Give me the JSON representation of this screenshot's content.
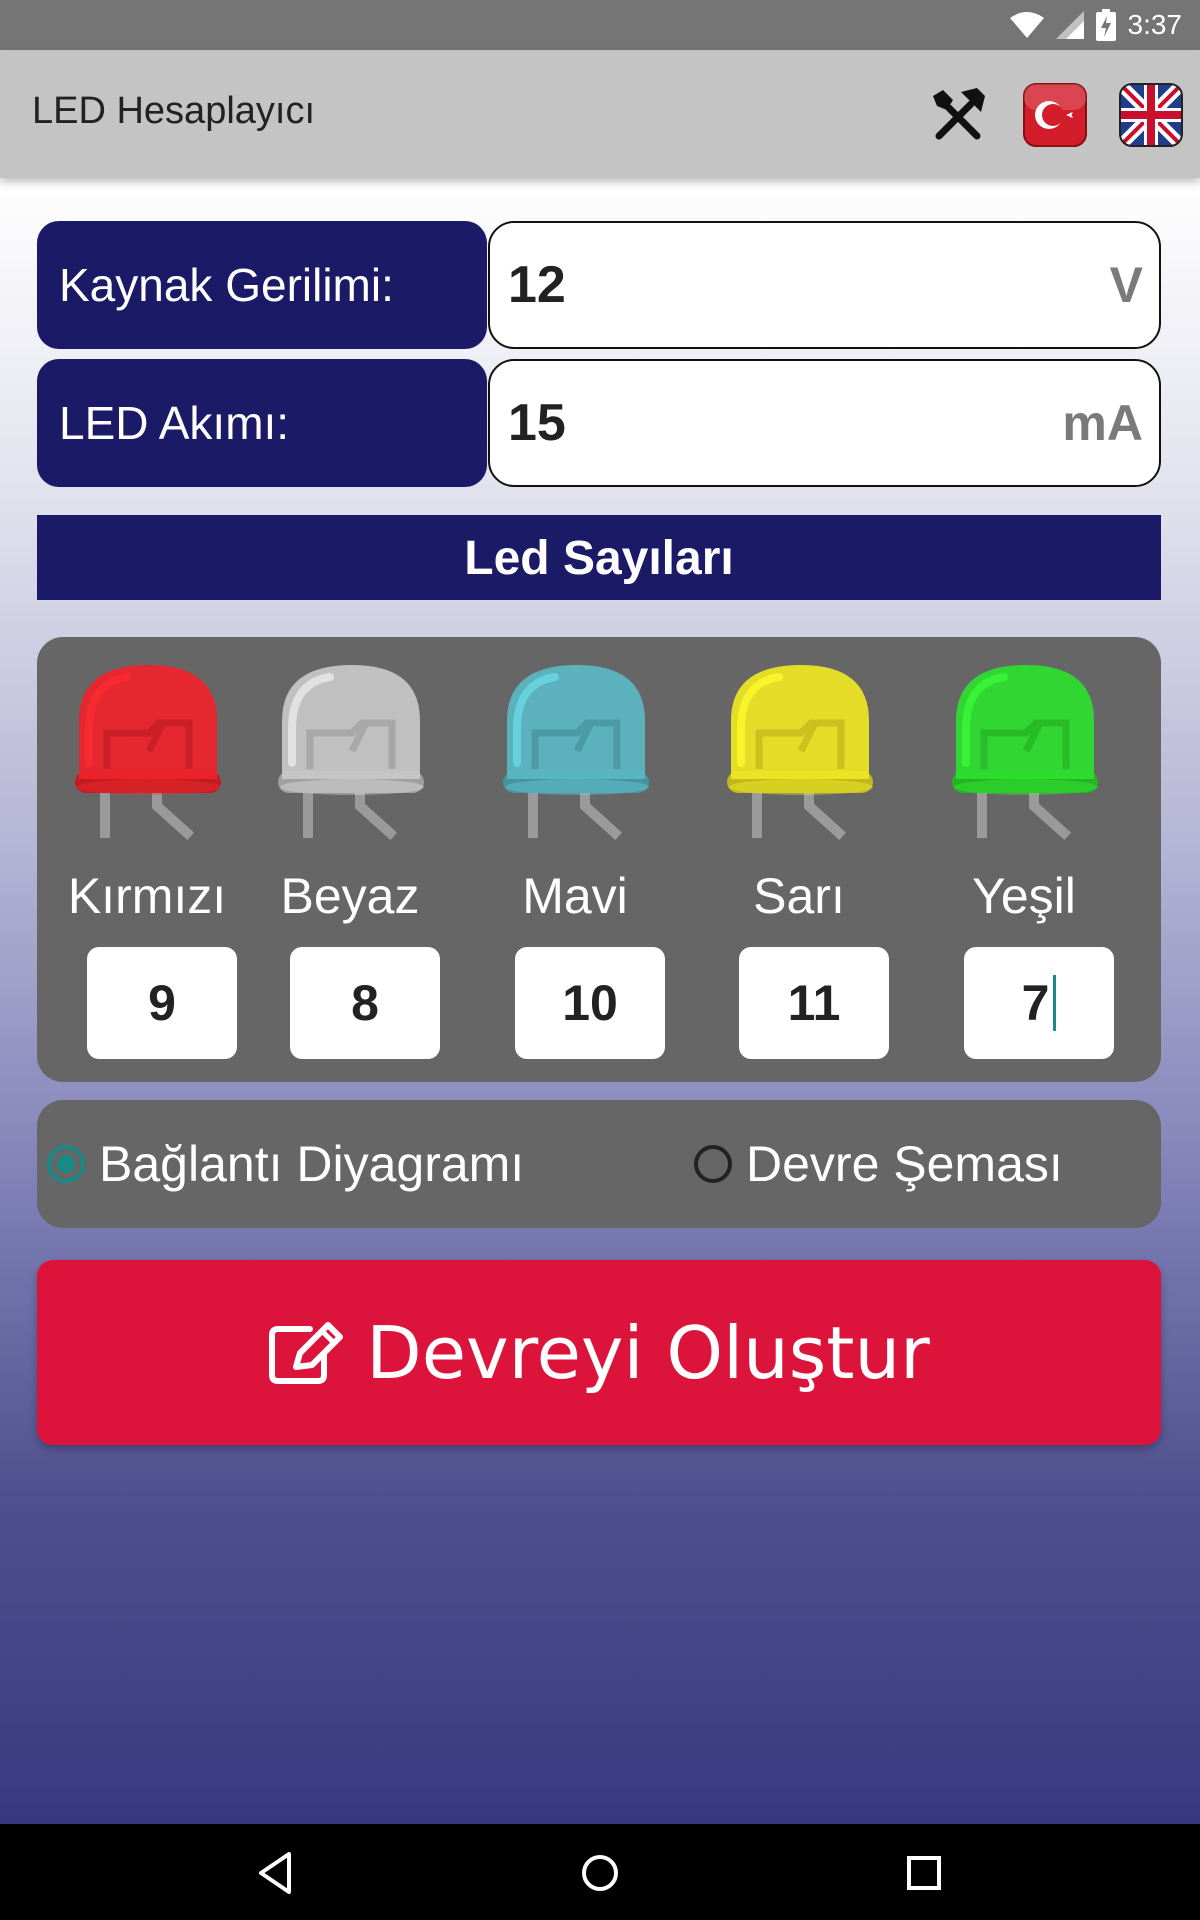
{
  "status_bar": {
    "time": "3:37"
  },
  "app": {
    "title": "LED Hesaplayıcı"
  },
  "action_bar": {
    "icons": [
      "tools-icon",
      "turkish-flag-icon",
      "uk-flag-icon"
    ]
  },
  "supply": {
    "label": "Kaynak Gerilimi:",
    "value": "12",
    "unit": "V"
  },
  "current": {
    "label": "LED Akımı:",
    "value": "15",
    "unit": "mA"
  },
  "led_section": {
    "title": "Led Sayıları"
  },
  "leds": [
    {
      "name": "Kırmızı",
      "count": "9",
      "color": "#f0232a"
    },
    {
      "name": "Beyaz",
      "count": "8",
      "color": "#c8c8c8"
    },
    {
      "name": "Mavi",
      "count": "10",
      "color": "#5ab8c4"
    },
    {
      "name": "Sarı",
      "count": "11",
      "color": "#f0e623"
    },
    {
      "name": "Yeşil",
      "count": "7",
      "color": "#2ee02e"
    }
  ],
  "output_mode": {
    "options": [
      "Bağlantı Diyagramı",
      "Devre Şeması"
    ],
    "selected": "Bağlantı Diyagramı"
  },
  "create_button": {
    "label": "Devreyi Oluştur"
  },
  "colors": {
    "primary": "#1a1a66",
    "accent": "#dc143c",
    "panel": "#666666",
    "radio_active": "#1a8a86"
  }
}
